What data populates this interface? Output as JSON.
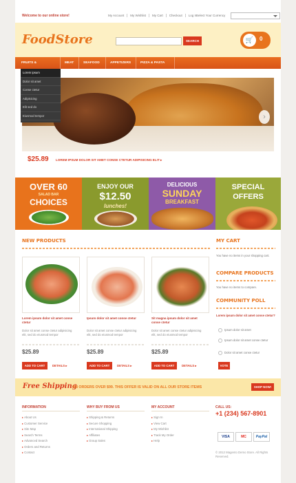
{
  "topbar": {
    "welcome": "Welcome to our online store!",
    "links": [
      "My Account",
      "My Wishlist",
      "My Cart",
      "Checkout",
      "Log In"
    ],
    "currency_label": "Select Your Currency"
  },
  "header": {
    "logo": "FoodStore",
    "search_button": "SEARCH",
    "cart_count": "0"
  },
  "nav": [
    "FRUITS & VEGETABLES",
    "MEAT",
    "SEAFOOD",
    "APPETIZERS",
    "PIZZA & PASTA"
  ],
  "dropdown": [
    "Lorem ipsum",
    "Dolor sit amet",
    "Conse ctetur",
    "Adipisicing",
    "Elit sed do",
    "Eiusmod tempor"
  ],
  "hero": {
    "price": "$25.89",
    "caption": "LOREM IPSUM DOLOR SIT AMET CONSE CTETUR ADIPISICING ELIT ▸"
  },
  "banners": [
    {
      "line1": "OVER 60",
      "line2": "SALAD BAR",
      "line3": "CHOICES",
      "color": "#e8731c"
    },
    {
      "line1": "ENJOY OUR",
      "line2": "$12.50",
      "line3": "lunches!",
      "color": "#8a9a2d"
    },
    {
      "line1": "DELICIOUS",
      "line2": "SUNDAY",
      "line3": "BREAKFAST",
      "color": "#8e5aa8"
    },
    {
      "line1": "SPECIAL",
      "line2": "OFFERS",
      "line3": "",
      "color": "#9aa83a"
    }
  ],
  "products": {
    "title": "NEW PRODUCTS",
    "items": [
      {
        "title": "Lorem ipsum dolor sit amet conse ctetur",
        "desc": "Dolor sit amet conse ctetur adipisicing elit, sed do eiusmod tempor",
        "price": "$25.89"
      },
      {
        "title": "Ipsum dolor sit amet conse ctetur",
        "desc": "Dolor sit amet conse ctetur adipisicing elit, sed do eiusmod tempor",
        "price": "$25.89"
      },
      {
        "title": "Sit magna ipsum dolor sit amet conse ctetur",
        "desc": "Dolor sit amet conse ctetur adipisicing elit, sed do eiusmod tempor",
        "price": "$25.89"
      }
    ],
    "add_to_cart": "ADD TO CART",
    "details": "DETAILS ▸"
  },
  "sidebar": {
    "cart_title": "MY CART",
    "cart_text": "You have no items in your shopping cart.",
    "compare_title": "COMPARE PRODUCTS",
    "compare_text": "You have no items to compare.",
    "poll_title": "COMMUNITY POLL",
    "poll_question": "Lorem ipsum dolor sit amet conse ctetur?",
    "poll_options": [
      "Ipsum dolor sit amet",
      "Ipsum dolor sit amet conse ctetur",
      "Dolor sit amet conse ctetur"
    ],
    "vote": "VOTE"
  },
  "shipping": {
    "free": "Free Shipping",
    "text": "ON ORDERS OVER $99. THIS OFFER IS VALID ON ALL OUR STORE ITEMS",
    "button": "SHOP NOW!"
  },
  "footer": {
    "columns": [
      {
        "title": "INFORMATION",
        "items": [
          "About Us",
          "Customer Service",
          "Site Map",
          "Search Terms",
          "Advanced Search",
          "Orders and Returns",
          "Contact"
        ]
      },
      {
        "title": "WHY BUY FROM US",
        "items": [
          "Shipping & Returns",
          "Secure Shopping",
          "International Shipping",
          "Affiliates",
          "Group Sales"
        ]
      },
      {
        "title": "MY ACCOUNT",
        "items": [
          "Sign In",
          "View Cart",
          "My Wishlist",
          "Track My Order",
          "Help"
        ]
      }
    ],
    "call_label": "CALL US:",
    "phone": "+1 (234) 567-8901",
    "payments": [
      "VISA",
      "MC",
      "PayPal"
    ],
    "copyright": "© 2012 Magento Demo Store. All Rights Reserved."
  }
}
